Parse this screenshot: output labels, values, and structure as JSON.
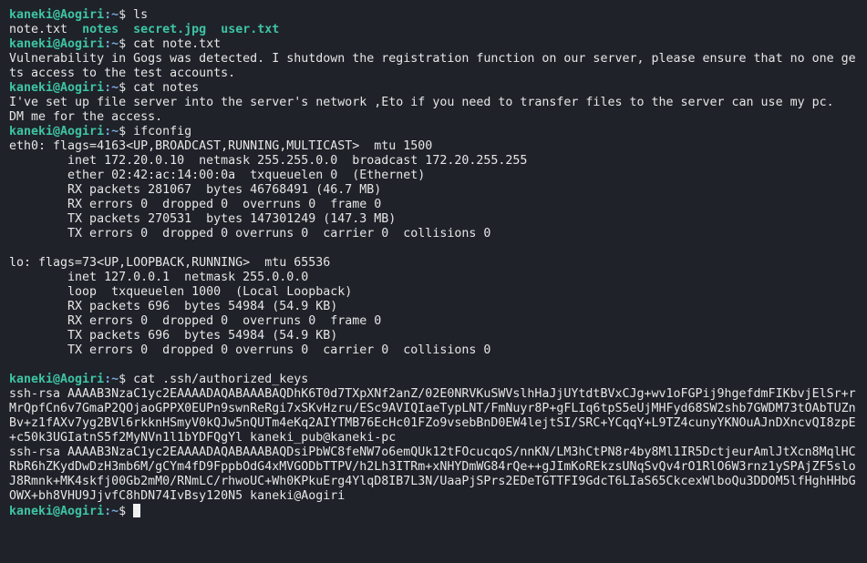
{
  "terminal": {
    "prompt_user": "kaneki@Aogiri",
    "prompt_path": ":~",
    "prompt_symbol": "$ ",
    "colors": {
      "background": "#1f2229",
      "prompt_user": "#3ec4a4",
      "prompt_path": "#7aa6da",
      "text": "#e6e6e6"
    },
    "lines": [
      {
        "prompt": true,
        "text": "ls"
      },
      {
        "segments": [
          {
            "t": "note.txt  "
          },
          {
            "t": "notes",
            "c": "teal"
          },
          {
            "t": "  "
          },
          {
            "t": "secret.jpg",
            "c": "teal"
          },
          {
            "t": "  "
          },
          {
            "t": "user.txt",
            "c": "teal"
          }
        ]
      },
      {
        "prompt": true,
        "text": "cat note.txt"
      },
      {
        "text": "Vulnerability in Gogs was detected. I shutdown the registration function on our server, please ensure that no one ge"
      },
      {
        "text": "ts access to the test accounts."
      },
      {
        "prompt": true,
        "text": "cat notes"
      },
      {
        "text": "I've set up file server into the server's network ,Eto if you need to transfer files to the server can use my pc."
      },
      {
        "text": "DM me for the access."
      },
      {
        "prompt": true,
        "text": "ifconfig"
      },
      {
        "text": "eth0: flags=4163<UP,BROADCAST,RUNNING,MULTICAST>  mtu 1500"
      },
      {
        "text": "        inet 172.20.0.10  netmask 255.255.0.0  broadcast 172.20.255.255"
      },
      {
        "text": "        ether 02:42:ac:14:00:0a  txqueuelen 0  (Ethernet)"
      },
      {
        "text": "        RX packets 281067  bytes 46768491 (46.7 MB)"
      },
      {
        "text": "        RX errors 0  dropped 0  overruns 0  frame 0"
      },
      {
        "text": "        TX packets 270531  bytes 147301249 (147.3 MB)"
      },
      {
        "text": "        TX errors 0  dropped 0 overruns 0  carrier 0  collisions 0"
      },
      {
        "text": ""
      },
      {
        "text": "lo: flags=73<UP,LOOPBACK,RUNNING>  mtu 65536"
      },
      {
        "text": "        inet 127.0.0.1  netmask 255.0.0.0"
      },
      {
        "text": "        loop  txqueuelen 1000  (Local Loopback)"
      },
      {
        "text": "        RX packets 696  bytes 54984 (54.9 KB)"
      },
      {
        "text": "        RX errors 0  dropped 0  overruns 0  frame 0"
      },
      {
        "text": "        TX packets 696  bytes 54984 (54.9 KB)"
      },
      {
        "text": "        TX errors 0  dropped 0 overruns 0  carrier 0  collisions 0"
      },
      {
        "text": ""
      },
      {
        "prompt": true,
        "text": "cat .ssh/authorized_keys"
      },
      {
        "text": "ssh-rsa AAAAB3NzaC1yc2EAAAADAQABAAABAQDhK6T0d7TXpXNf2anZ/02E0NRVKuSWVslhHaJjUYtdtBVxCJg+wv1oFGPij9hgefdmFIKbvjElSr+r"
      },
      {
        "text": "MrQpfCn6v7GmaP2QOjaoGPPX0EUPn9swnReRgi7xSKvHzru/ESc9AVIQIaeTypLNT/FmNuyr8P+gFLIq6tpS5eUjMHFyd68SW2shb7GWDM73tOAbTUZn"
      },
      {
        "text": "Bv+z1fAXv7yg2BVl6rkknHSmyV0kQJw5nQUTm4eKq2AIYTMB76EcHc01FZo9vsebBnD0EW4lejtSI/SRC+YCqqY+L9TZ4cunyYKNOuAJnDXncvQI8zpE"
      },
      {
        "text": "+c50k3UGIatnS5f2MyNVn1l1bYDFQgYl kaneki_pub@kaneki-pc"
      },
      {
        "text": "ssh-rsa AAAAB3NzaC1yc2EAAAADAQABAAABAQDsiPbWC8feNW7o6emQUk12tFOcucqoS/nnKN/LM3hCtPN8r4by8Ml1IR5DctjeurAmlJtXcn8MqlHC"
      },
      {
        "text": "RbR6hZKydDwDzH3mb6M/gCYm4fD9FppbOdG4xMVGODbTTPV/h2Lh3ITRm+xNHYDmWG84rQe++gJImKoREkzsUNqSvQv4rO1RlO6W3rnz1ySPAjZF5slo"
      },
      {
        "text": "J8Rmnk+MK4skfj00Gb2mM0/RNmLC/rhwoUC+Wh0KPkuErg4YlqD8IB7L3N/UaaPjSPrs2EDeTGTTFI9GdcT6LIaS65CkcexWlboQu3DDOM5lfHghHHbG"
      },
      {
        "text": "OWX+bh8VHU9JjvfC8hDN74IvBsy120N5 kaneki@Aogiri"
      },
      {
        "prompt": true,
        "text": "",
        "cursor": true
      }
    ]
  }
}
